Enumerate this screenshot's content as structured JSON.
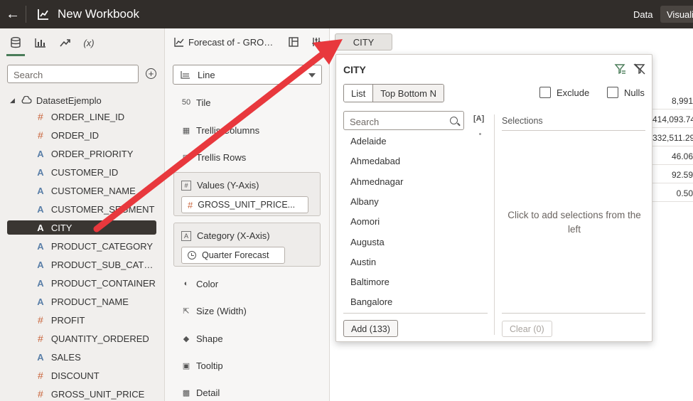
{
  "topbar": {
    "title": "New Workbook",
    "data_tab": "Data",
    "visualize_tab": "Visuali"
  },
  "left_panel": {
    "search_placeholder": "Search",
    "tabs": [
      "data-icon",
      "visualizations-icon",
      "analytics-icon",
      "calculations-icon"
    ],
    "calculations_label": "(x)",
    "dataset_name": "DatasetEjemplo",
    "fields": [
      {
        "type": "measure",
        "name": "ORDER_LINE_ID"
      },
      {
        "type": "measure",
        "name": "ORDER_ID"
      },
      {
        "type": "attribute",
        "name": "ORDER_PRIORITY"
      },
      {
        "type": "attribute",
        "name": "CUSTOMER_ID"
      },
      {
        "type": "attribute",
        "name": "CUSTOMER_NAME"
      },
      {
        "type": "attribute",
        "name": "CUSTOMER_SEGMENT"
      },
      {
        "type": "attribute",
        "name": "CITY",
        "selected": true
      },
      {
        "type": "attribute",
        "name": "PRODUCT_CATEGORY"
      },
      {
        "type": "attribute",
        "name": "PRODUCT_SUB_CATEGORY"
      },
      {
        "type": "attribute",
        "name": "PRODUCT_CONTAINER"
      },
      {
        "type": "attribute",
        "name": "PRODUCT_NAME"
      },
      {
        "type": "measure",
        "name": "PROFIT"
      },
      {
        "type": "measure",
        "name": "QUANTITY_ORDERED"
      },
      {
        "type": "attribute",
        "name": "SALES"
      },
      {
        "type": "measure",
        "name": "DISCOUNT"
      },
      {
        "type": "measure",
        "name": "GROSS_UNIT_PRICE"
      }
    ]
  },
  "grammar_panel": {
    "viz_title": "Forecast of - GROSS_UNIT_PRICE",
    "chart_type": "Line",
    "tile": "Tile",
    "trellis_columns": "Trellis Columns",
    "trellis_rows": "Trellis Rows",
    "values_label": "Values (Y-Axis)",
    "values_pill": "GROSS_UNIT_PRICE...",
    "category_label": "Category (X-Axis)",
    "category_pill": "Quarter Forecast",
    "color": "Color",
    "size": "Size (Width)",
    "shape": "Shape",
    "tooltip": "Tooltip",
    "detail": "Detail"
  },
  "canvas": {
    "filter_chip": "CITY",
    "background_values": [
      "8,991",
      "414,093.74",
      "332,511.29",
      "46.06",
      "92.59",
      "0.50"
    ]
  },
  "filter_popup": {
    "title": "CITY",
    "tab_list": "List",
    "tab_top_bottom": "Top Bottom N",
    "exclude_label": "Exclude",
    "nulls_label": "Nulls",
    "search_placeholder": "Search",
    "case_toggle": "[A]",
    "cities": [
      "Adelaide",
      "Ahmedabad",
      "Ahmednagar",
      "Albany",
      "Aomori",
      "Augusta",
      "Austin",
      "Baltimore",
      "Bangalore"
    ],
    "selections_label": "Selections",
    "selections_hint": "Click to add selections from the left",
    "add_button": "Add (133)",
    "clear_button": "Clear (0)"
  },
  "colors": {
    "topbar_bg": "#312d2a",
    "selected_row_bg": "#3a3632",
    "measure_icon": "#c9653c",
    "attribute_icon": "#5a7fa8",
    "arrow": "#e8383d",
    "active_tab": "#4a7c59"
  }
}
